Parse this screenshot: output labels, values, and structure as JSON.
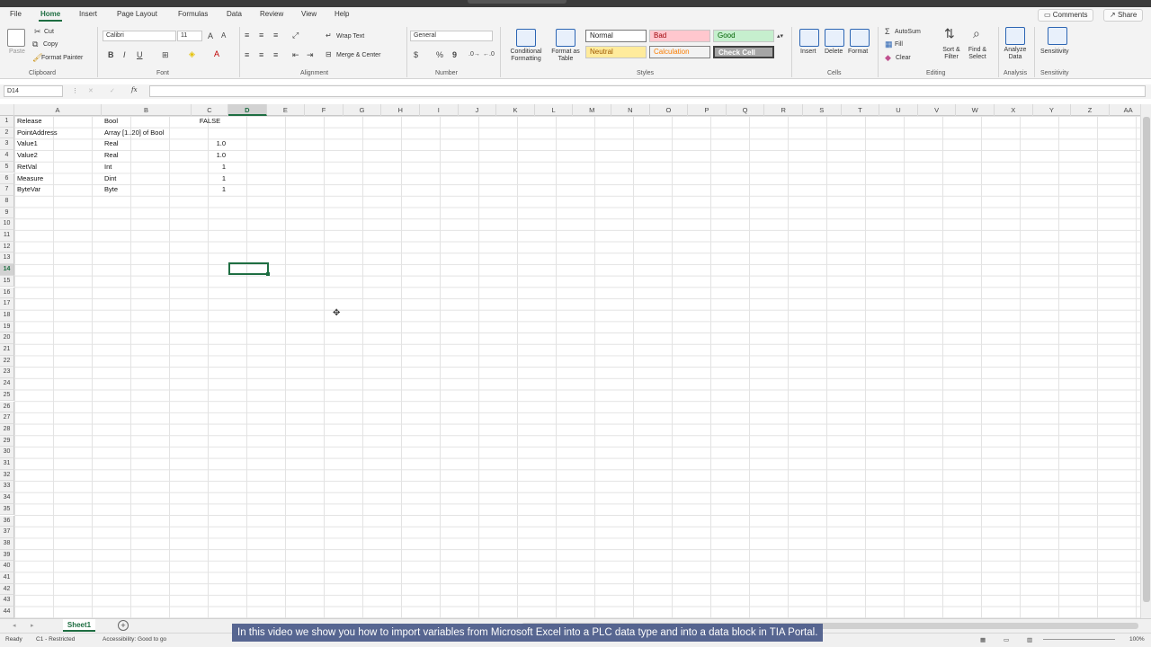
{
  "menu": {
    "tabs": [
      "File",
      "Home",
      "Insert",
      "Page Layout",
      "Formulas",
      "Data",
      "Review",
      "View",
      "Help"
    ],
    "active": "Home",
    "comments_label": "Comments",
    "share_label": "Share"
  },
  "ribbon": {
    "clipboard": {
      "paste": "Paste",
      "cut": "Cut",
      "copy": "Copy",
      "format_painter": "Format Painter",
      "label": "Clipboard"
    },
    "font": {
      "name": "Calibri",
      "size": "11",
      "label": "Font",
      "bold": "B",
      "italic": "I",
      "underline": "U"
    },
    "alignment": {
      "wrap_text": "Wrap Text",
      "merge_center": "Merge & Center",
      "label": "Alignment"
    },
    "number": {
      "format": "General",
      "label": "Number",
      "currency": "$",
      "percent": "%",
      "comma": "9"
    },
    "styles": {
      "conditional": "Conditional Formatting",
      "format_table": "Format as Table",
      "normal": "Normal",
      "bad": "Bad",
      "good": "Good",
      "neutral": "Neutral",
      "calculation": "Calculation",
      "check_cell": "Check Cell",
      "label": "Styles",
      "colors": {
        "normal_bg": "#ffffff",
        "bad_bg": "#ffc7ce",
        "bad_fg": "#9c0006",
        "good_bg": "#c6efce",
        "good_fg": "#006100",
        "neutral_bg": "#ffeb9c",
        "neutral_fg": "#9c5700",
        "calc_bg": "#f2f2f2",
        "calc_fg": "#fa7d00",
        "check_bg": "#a5a5a5",
        "check_fg": "#ffffff"
      }
    },
    "cells": {
      "insert": "Insert",
      "delete": "Delete",
      "format": "Format",
      "label": "Cells"
    },
    "editing": {
      "autosum": "AutoSum",
      "fill": "Fill",
      "clear": "Clear",
      "sort_filter": "Sort & Filter",
      "find_select": "Find & Select",
      "label": "Editing"
    },
    "analysis": {
      "analyze": "Analyze Data",
      "label": "Analysis"
    },
    "sensitivity": {
      "button": "Sensitivity",
      "label": "Sensitivity"
    }
  },
  "formula_bar": {
    "name_box": "D14",
    "fx": "fx",
    "content": ""
  },
  "columns": [
    "A",
    "B",
    "C",
    "D",
    "E",
    "F",
    "G",
    "H",
    "I",
    "J",
    "K",
    "L",
    "M",
    "N",
    "O",
    "P",
    "Q",
    "R",
    "S",
    "T",
    "U",
    "V",
    "W",
    "X",
    "Y",
    "Z",
    "AA"
  ],
  "selected_column": "D",
  "selected_row": "14",
  "rows": [
    "1",
    "2",
    "3",
    "4",
    "5",
    "6",
    "7",
    "8",
    "9",
    "10",
    "11",
    "12",
    "13",
    "14",
    "15",
    "16",
    "17",
    "18",
    "19",
    "20",
    "21",
    "22",
    "23",
    "24",
    "25",
    "26",
    "27",
    "28",
    "29",
    "30",
    "31",
    "32",
    "33",
    "34",
    "35",
    "36",
    "37",
    "38",
    "39",
    "40",
    "41",
    "42",
    "43",
    "44"
  ],
  "cells": [
    [
      "Release",
      "Bool",
      "FALSE"
    ],
    [
      "PointAddress",
      "Array [1..20] of Bool",
      ""
    ],
    [
      "Value1",
      "Real",
      "1.0"
    ],
    [
      "Value2",
      "Real",
      "1.0"
    ],
    [
      "RetVal",
      "Int",
      "1"
    ],
    [
      "Measure",
      "Dint",
      "1"
    ],
    [
      "ByteVar",
      "Byte",
      "1"
    ]
  ],
  "sheet_tab": "Sheet1",
  "status": {
    "ready": "Ready",
    "classification": "C1 - Restricted",
    "accessibility": "Accessibility: Good to go",
    "zoom": "100%"
  },
  "caption": "In this video we show you how to import variables from Microsoft Excel into a PLC data type and into a data block in TIA Portal.",
  "colors": {
    "accent": "#1e6e42",
    "caption_bg": "#4f5f8c"
  }
}
